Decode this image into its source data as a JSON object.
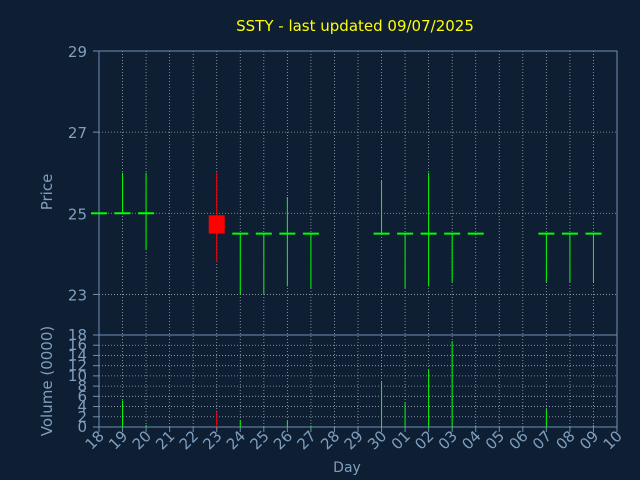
{
  "colors": {
    "background": "#0f1f33",
    "title": "#ffff00",
    "axis_text": "#7f9fbf",
    "axis_line": "#6f8fb0",
    "grid": "#d0d8e0",
    "up": "#00ff00",
    "down": "#ff0000"
  },
  "chart_data": [
    {
      "type": "candlestick",
      "title": "SSTY - last updated 09/07/2025",
      "ylabel": "Price",
      "ylim": [
        22,
        29
      ],
      "yticks": [
        23,
        25,
        27,
        29
      ],
      "grid": true,
      "x": [
        "18",
        "19",
        "20",
        "21",
        "22",
        "23",
        "24",
        "25",
        "26",
        "27",
        "28",
        "29",
        "30",
        "01",
        "02",
        "03",
        "04",
        "05",
        "06",
        "07",
        "08",
        "09",
        "10"
      ],
      "candles": [
        {
          "x": "18",
          "open": 25.0,
          "high": 25.0,
          "low": 25.0,
          "close": 25.0
        },
        {
          "x": "19",
          "open": 25.0,
          "high": 26.0,
          "low": 25.0,
          "close": 25.0
        },
        {
          "x": "20",
          "open": 25.0,
          "high": 26.0,
          "low": 24.1,
          "close": 25.0
        },
        {
          "x": "23",
          "open": 24.95,
          "high": 26.0,
          "low": 23.8,
          "close": 24.5
        },
        {
          "x": "24",
          "open": 24.5,
          "high": 24.5,
          "low": 23.0,
          "close": 24.5
        },
        {
          "x": "25",
          "open": 24.5,
          "high": 24.5,
          "low": 23.0,
          "close": 24.5
        },
        {
          "x": "26",
          "open": 24.5,
          "high": 25.4,
          "low": 23.2,
          "close": 24.5
        },
        {
          "x": "27",
          "open": 24.5,
          "high": 24.5,
          "low": 23.15,
          "close": 24.5
        },
        {
          "x": "30",
          "open": 24.5,
          "high": 25.8,
          "low": 24.5,
          "close": 24.5
        },
        {
          "x": "01",
          "open": 24.5,
          "high": 24.5,
          "low": 23.15,
          "close": 24.5
        },
        {
          "x": "02",
          "open": 24.5,
          "high": 26.0,
          "low": 23.2,
          "close": 24.5
        },
        {
          "x": "03",
          "open": 24.5,
          "high": 24.5,
          "low": 23.3,
          "close": 24.5
        },
        {
          "x": "04",
          "open": 24.5,
          "high": 24.5,
          "low": 24.5,
          "close": 24.5
        },
        {
          "x": "07",
          "open": 24.5,
          "high": 24.5,
          "low": 23.3,
          "close": 24.5
        },
        {
          "x": "08",
          "open": 24.5,
          "high": 24.5,
          "low": 23.3,
          "close": 24.5
        },
        {
          "x": "09",
          "open": 24.5,
          "high": 24.5,
          "low": 23.3,
          "close": 24.5
        }
      ]
    },
    {
      "type": "bar",
      "ylabel": "Volume (0000)",
      "xlabel": "Day",
      "ylim": [
        0,
        18
      ],
      "yticks": [
        0,
        2,
        4,
        6,
        8,
        10,
        12,
        14,
        16,
        18
      ],
      "grid": true,
      "x": [
        "18",
        "19",
        "20",
        "21",
        "22",
        "23",
        "24",
        "25",
        "26",
        "27",
        "28",
        "29",
        "30",
        "01",
        "02",
        "03",
        "04",
        "05",
        "06",
        "07",
        "08",
        "09",
        "10"
      ],
      "bars": [
        {
          "x": "19",
          "value": 5.2,
          "color": "up"
        },
        {
          "x": "20",
          "value": 0.4,
          "color": "up"
        },
        {
          "x": "23",
          "value": 3.0,
          "color": "down"
        },
        {
          "x": "24",
          "value": 1.3,
          "color": "up"
        },
        {
          "x": "25",
          "value": 0.2,
          "color": "up"
        },
        {
          "x": "26",
          "value": 1.2,
          "color": "up"
        },
        {
          "x": "27",
          "value": 0.3,
          "color": "up"
        },
        {
          "x": "30",
          "value": 8.8,
          "color": "up"
        },
        {
          "x": "01",
          "value": 4.8,
          "color": "up"
        },
        {
          "x": "02",
          "value": 11.3,
          "color": "up"
        },
        {
          "x": "03",
          "value": 16.8,
          "color": "up"
        },
        {
          "x": "04",
          "value": 0.3,
          "color": "up"
        },
        {
          "x": "07",
          "value": 3.5,
          "color": "up"
        },
        {
          "x": "08",
          "value": 0.2,
          "color": "up"
        },
        {
          "x": "09",
          "value": 0.4,
          "color": "up"
        }
      ]
    }
  ]
}
